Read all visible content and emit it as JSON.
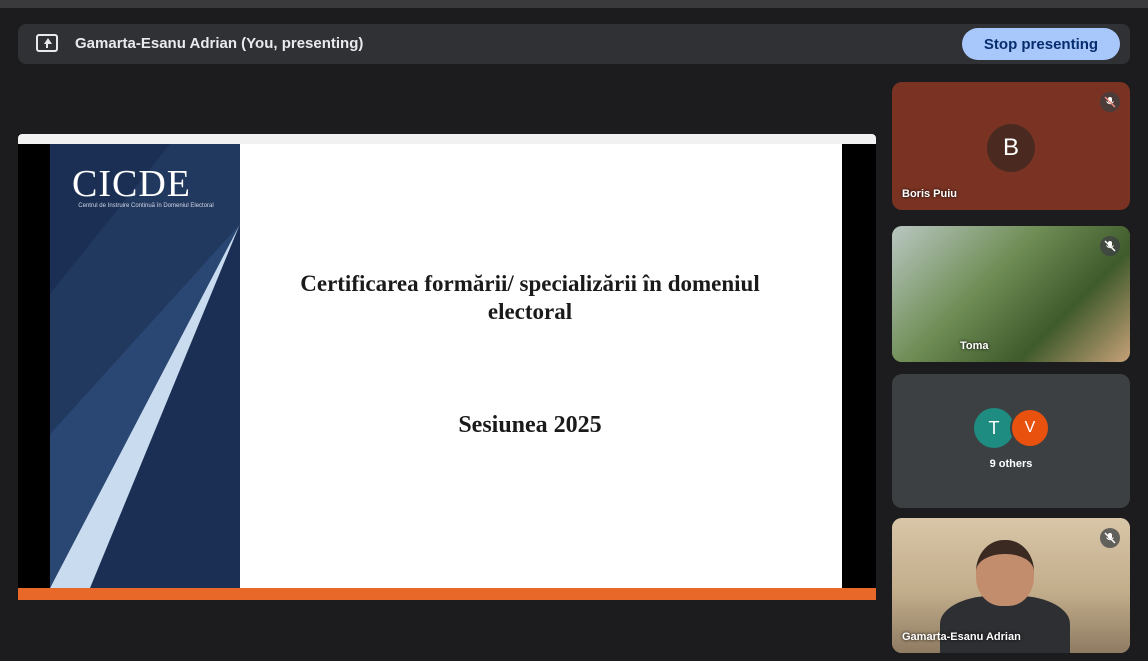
{
  "presenting_bar": {
    "label": "Gamarta-Esanu Adrian (You, presenting)",
    "stop_button": "Stop presenting"
  },
  "slide": {
    "logo": "CICDE",
    "logo_subtitle": "Centrul de Instruire Continuă în Domeniul Electoral",
    "title": "Certificarea formării/ specializării în domeniul electoral",
    "session": "Sesiunea 2025"
  },
  "participants": {
    "boris": {
      "initial": "B",
      "name": "Boris Puiu"
    },
    "toma": {
      "name": "Toma"
    },
    "others": {
      "initial_1": "T",
      "initial_2": "V",
      "label": "9 others"
    },
    "gamarta": {
      "name": "Gamarta-Esanu Adrian"
    }
  },
  "colors": {
    "stop_button_bg": "#a8c7fa",
    "avatar_t": "#1e8c80",
    "avatar_v": "#e8510e",
    "slide_band": "#1b2f55"
  }
}
